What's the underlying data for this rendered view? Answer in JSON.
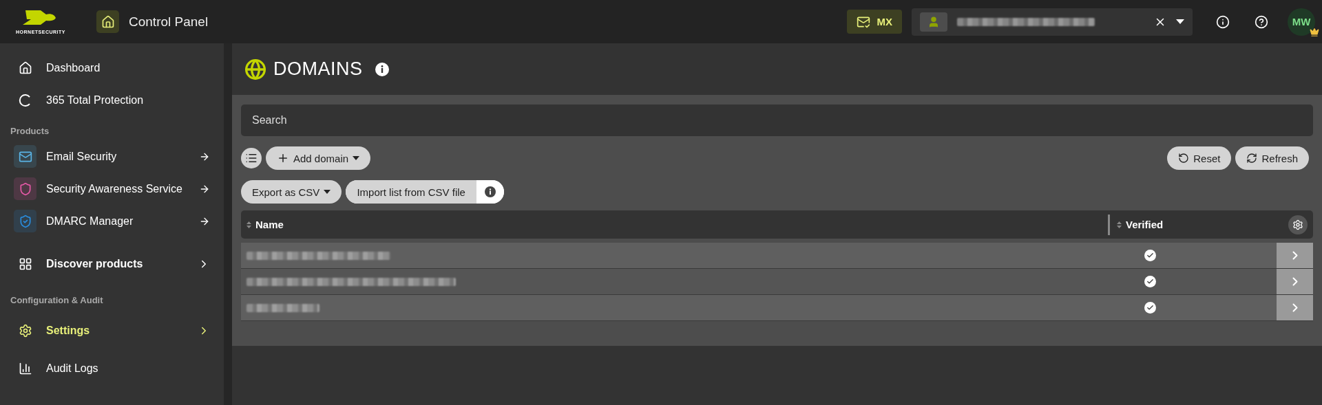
{
  "header": {
    "brand": "HORNETSECURITY",
    "title": "Control Panel",
    "mx_label": "MX",
    "avatar_initials": "MW"
  },
  "sidebar": {
    "items": [
      {
        "kind": "link",
        "label": "Dashboard",
        "selected": false
      },
      {
        "kind": "link",
        "label": "365 Total Protection",
        "selected": false
      },
      {
        "kind": "heading",
        "label": "Products"
      },
      {
        "kind": "product",
        "color": "#5ab4e6",
        "label": "Email Security",
        "selected": false
      },
      {
        "kind": "product",
        "color": "#e85aa8",
        "label": "Security Awareness Service",
        "selected": false
      },
      {
        "kind": "product",
        "color": "#2a8ee0",
        "label": "DMARC Manager",
        "selected": false
      },
      {
        "kind": "group",
        "label": "Discover products",
        "selected": false
      },
      {
        "kind": "heading",
        "label": "Configuration & Audit"
      },
      {
        "kind": "group",
        "label": "Settings",
        "selected": true
      },
      {
        "kind": "link",
        "label": "Audit Logs",
        "selected": false
      }
    ]
  },
  "page": {
    "title": "DOMAINS",
    "search": {
      "placeholder": "Search"
    },
    "toolbar": {
      "add_label": "Add domain",
      "reset_label": "Reset",
      "refresh_label": "Refresh",
      "export_label": "Export as CSV",
      "import_label": "Import list from CSV file"
    },
    "table": {
      "columns": [
        "Name",
        "Verified"
      ],
      "rows": [
        {
          "verified": true
        },
        {
          "verified": true
        },
        {
          "verified": true
        }
      ]
    }
  }
}
